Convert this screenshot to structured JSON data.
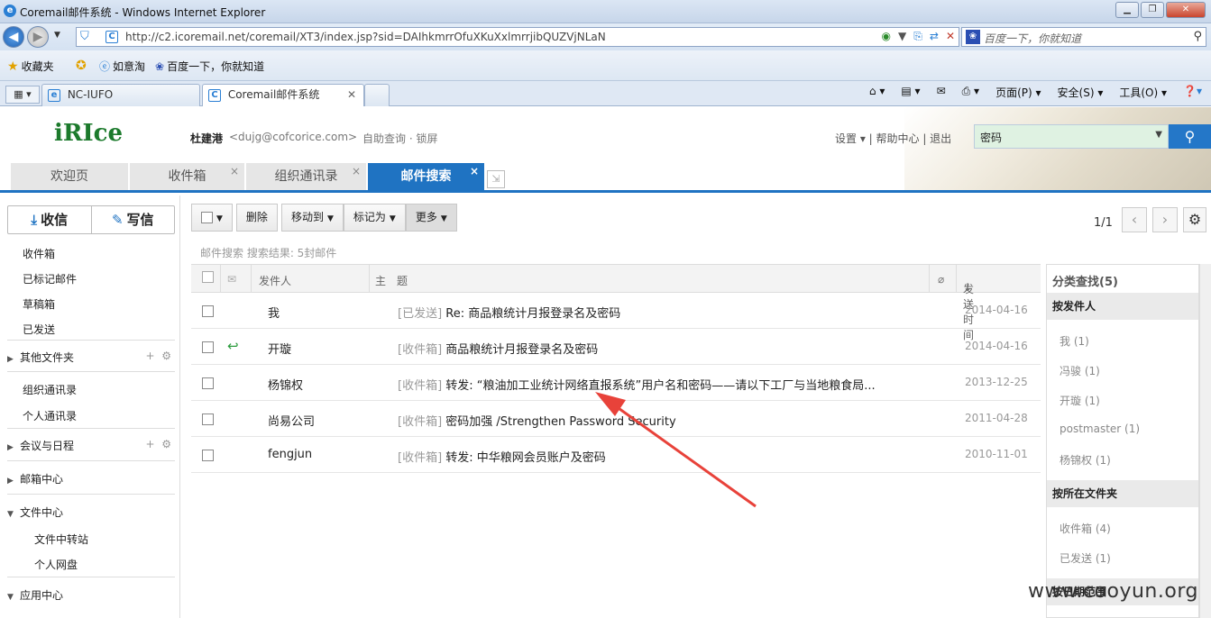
{
  "browser": {
    "title": "Coremail邮件系统 - Windows Internet Explorer",
    "url": "http://c2.icoremail.net/coremail/XT3/index.jsp?sid=DAIhkmrrOfuXKuXxlmrrjibQUZVjNLaN",
    "search_placeholder": "百度一下，你就知道",
    "favorites": {
      "label": "收藏夹",
      "items": [
        "如意淘",
        "百度一下，你就知道"
      ]
    },
    "tabs": [
      {
        "label": "NC-IUFO"
      },
      {
        "label": "Coremail邮件系统"
      }
    ],
    "commands": [
      "页面(P)",
      "安全(S)",
      "工具(O)"
    ]
  },
  "header": {
    "logo": "iRIce",
    "user_name": "杜建港",
    "user_email": "<dujg@cofcorice.com>",
    "links": "自助查询 · 锁屏",
    "right_links": "设置 ▾  |  帮助中心  |  退出",
    "search_value": "密码"
  },
  "mail_tabs": [
    "欢迎页",
    "收件箱",
    "组织通讯录",
    "邮件搜索"
  ],
  "sidebar": {
    "receive": "收信",
    "compose": "写信",
    "folders": [
      "收件箱",
      "已标记邮件",
      "草稿箱",
      "已发送"
    ],
    "other_folders": "其他文件夹",
    "contacts": [
      "组织通讯录",
      "个人通讯录"
    ],
    "calendar": "会议与日程",
    "mailbox_center": "邮箱中心",
    "file_center": "文件中心",
    "file_subs": [
      "文件中转站",
      "个人网盘"
    ],
    "app_center": "应用中心"
  },
  "toolbar": {
    "delete": "删除",
    "move_to": "移动到",
    "mark_as": "标记为",
    "more": "更多",
    "pager": "1/1"
  },
  "result_info": "邮件搜索  搜索结果: 5封邮件",
  "table": {
    "col_sender": "发件人",
    "col_subject": "主　题",
    "col_date": "发送时间",
    "rows": [
      {
        "sender": "我",
        "folder": "[已发送]",
        "subject": "Re: 商品粮统计月报登录名及密码",
        "date": "2014-04-16",
        "replied": false
      },
      {
        "sender": "开璇",
        "folder": "[收件箱]",
        "subject": "商品粮统计月报登录名及密码",
        "date": "2014-04-16",
        "replied": true
      },
      {
        "sender": "杨锦权",
        "folder": "[收件箱]",
        "subject": "转发: “粮油加工业统计网络直报系统”用户名和密码——请以下工厂与当地粮食局...",
        "date": "2013-12-25",
        "replied": false
      },
      {
        "sender": "尚易公司",
        "folder": "[收件箱]",
        "subject": "密码加强 /Strengthen Password Security",
        "date": "2011-04-28",
        "replied": false
      },
      {
        "sender": "fengjun",
        "folder": "[收件箱]",
        "subject": "转发: 中华粮网会员账户及密码",
        "date": "2010-11-01",
        "replied": false
      }
    ]
  },
  "right_panel": {
    "title": "分类查找(5)",
    "by_sender": "按发件人",
    "senders": [
      "我 (1)",
      "冯骏 (1)",
      "开璇 (1)",
      "postmaster (1)",
      "杨锦权 (1)"
    ],
    "by_folder": "按所在文件夹",
    "folders": [
      "收件箱 (4)",
      "已发送 (1)"
    ],
    "by_date": "按日期范围"
  },
  "watermark": "www.cooyun.org",
  "colors": {
    "accent": "#1f73c2",
    "annotation_arrow": "#e8423a"
  }
}
